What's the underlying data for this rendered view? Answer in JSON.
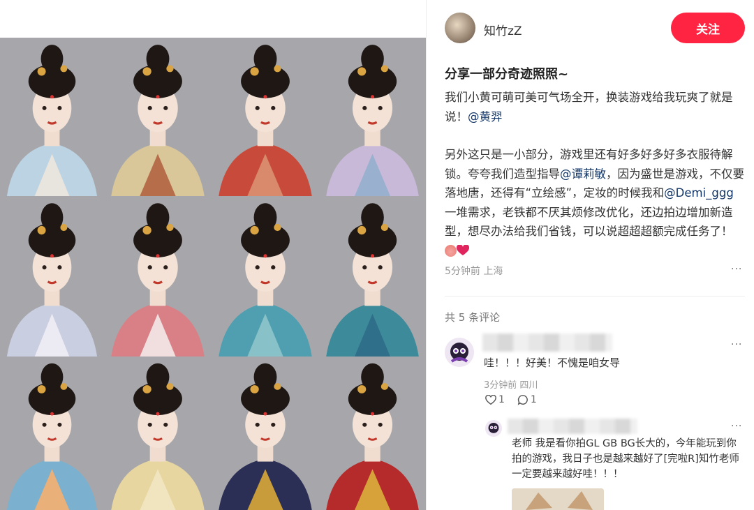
{
  "post": {
    "author": "知竹zZ",
    "follow_label": "关注",
    "title": "分享一部分奇迹照照~",
    "body_line1a": "我们小黄可萌可美可气场全开，换装游戏给我玩爽了就是说！",
    "mention1": "@黄羿",
    "body_line2a": "另外这只是一小部分，游戏里还有好多好多好多衣服待解锁。夸夸我们造型指导",
    "mention2": "@谭莉敏",
    "body_line2b": "，因为盛世是游戏，不仅要落地唐，还得有“立绘感”，定妆的时候我和",
    "mention3": "@Demi_ggg",
    "body_line2c": "一堆需求，老铁都不厌其烦修改优化，还边拍边增加新造型，想尽办法给我们省钱，可以说超超超额完成任务了！",
    "meta": "5分钟前 上海",
    "more": "···"
  },
  "comments": {
    "count_label": "共 5 条评论",
    "items": [
      {
        "text": "哇！！！好美！不愧是咱女导",
        "meta": "3分钟前 四川",
        "likes": "1",
        "replies": "1",
        "more": "···"
      }
    ],
    "reply": {
      "text": "老师 我是看你拍GL GB BG长大的，今年能玩到你拍的游戏，我日子也是越来越好了[完啦R]知竹老师一定要越来越好哇！！！",
      "more": "···"
    }
  },
  "icons": [
    "heart-icon",
    "comment-icon",
    "peach-emoji-icon",
    "red-heart-emoji-icon"
  ],
  "colors": {
    "accent": "#ff2442",
    "mention": "#133667"
  }
}
